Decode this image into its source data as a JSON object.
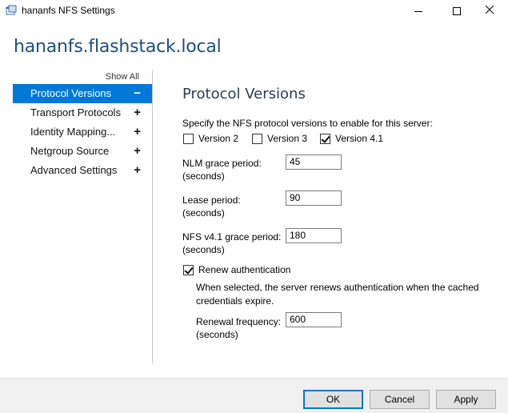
{
  "window": {
    "title": "hananfs NFS Settings",
    "icon": "nfs-settings-app-icon"
  },
  "server_name": "hananfs.flashstack.local",
  "nav": {
    "show_all": "Show All",
    "items": [
      {
        "label": "Protocol Versions",
        "sign": "−",
        "active": true
      },
      {
        "label": "Transport Protocols",
        "sign": "+"
      },
      {
        "label": "Identity Mapping...",
        "sign": "+"
      },
      {
        "label": "Netgroup Source",
        "sign": "+"
      },
      {
        "label": "Advanced Settings",
        "sign": "+"
      }
    ]
  },
  "main": {
    "title": "Protocol Versions",
    "instruction": "Specify the NFS protocol versions to enable for this server:",
    "versions": [
      {
        "label": "Version 2",
        "checked": false
      },
      {
        "label": "Version 3",
        "checked": false
      },
      {
        "label": "Version 4.1",
        "checked": true
      }
    ],
    "nlm": {
      "label1": "NLM grace period:",
      "label2": "(seconds)",
      "value": "45"
    },
    "lease": {
      "label1": "Lease period:",
      "label2": "(seconds)",
      "value": "90"
    },
    "nfs41": {
      "label1": "NFS v4.1 grace period:",
      "label2": "(seconds)",
      "value": "180"
    },
    "renew": {
      "label": "Renew authentication",
      "checked": true,
      "desc1": "When selected, the server renews authentication when the cached",
      "desc2": "credentials expire.",
      "freq_label1": "Renewal frequency:",
      "freq_label2": "(seconds)",
      "freq_value": "600"
    }
  },
  "footer": {
    "ok": "OK",
    "cancel": "Cancel",
    "apply": "Apply"
  },
  "colors": {
    "accent": "#0078d7",
    "server_name": "#1e4f7e"
  }
}
